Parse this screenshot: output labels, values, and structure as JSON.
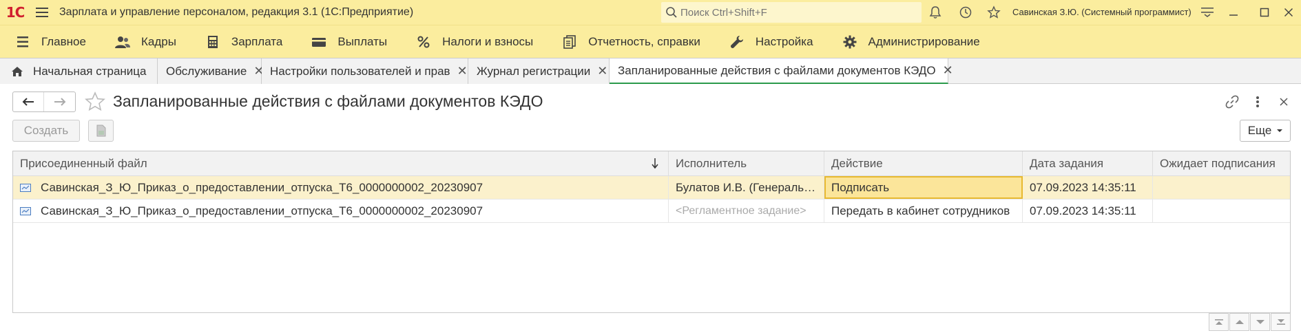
{
  "titlebar": {
    "logo": "1С",
    "title": "Зарплата и управление персоналом, редакция 3.1  (1С:Предприятие)",
    "search_placeholder": "Поиск Ctrl+Shift+F",
    "user": "Савинская З.Ю. (Системный программист)"
  },
  "sections": [
    {
      "label": "Главное",
      "icon": "menu-list-icon"
    },
    {
      "label": "Кадры",
      "icon": "people-icon"
    },
    {
      "label": "Зарплата",
      "icon": "calculator-icon"
    },
    {
      "label": "Выплаты",
      "icon": "wallet-icon"
    },
    {
      "label": "Налоги и взносы",
      "icon": "percent-icon"
    },
    {
      "label": "Отчетность, справки",
      "icon": "reports-icon"
    },
    {
      "label": "Настройка",
      "icon": "wrench-icon"
    },
    {
      "label": "Администрирование",
      "icon": "gear-icon"
    }
  ],
  "tabs": [
    {
      "label": "Начальная страница"
    },
    {
      "label": "Обслуживание"
    },
    {
      "label": "Настройки пользователей и прав"
    },
    {
      "label": "Журнал регистрации"
    },
    {
      "label": "Запланированные действия с файлами документов КЭДО"
    }
  ],
  "form": {
    "title": "Запланированные действия с файлами документов КЭДО",
    "create_label": "Создать",
    "more_label": "Еще"
  },
  "table": {
    "columns": [
      "Присоединенный файл",
      "Исполнитель",
      "Действие",
      "Дата задания",
      "Ожидает подписания"
    ],
    "rows": [
      {
        "file": "Савинская_З_Ю_Приказ_о_предоставлении_отпуска_Т6_0000000002_20230907",
        "executor": "Булатов И.В. (Генеральный директор)",
        "action": "Подписать",
        "date": "07.09.2023 14:35:11",
        "waiting": ""
      },
      {
        "file": "Савинская_З_Ю_Приказ_о_предоставлении_отпуска_Т6_0000000002_20230907",
        "executor": "<Регламентное задание>",
        "action": "Передать в кабинет сотрудников",
        "date": "07.09.2023 14:35:11",
        "waiting": ""
      }
    ]
  },
  "colors": {
    "accent_yellow": "#fbed9e",
    "logo_red": "#d0202e",
    "active_tab_underline": "#2a9a4a",
    "selected_row": "#fbf1cc",
    "current_cell": "#fbe59a"
  }
}
